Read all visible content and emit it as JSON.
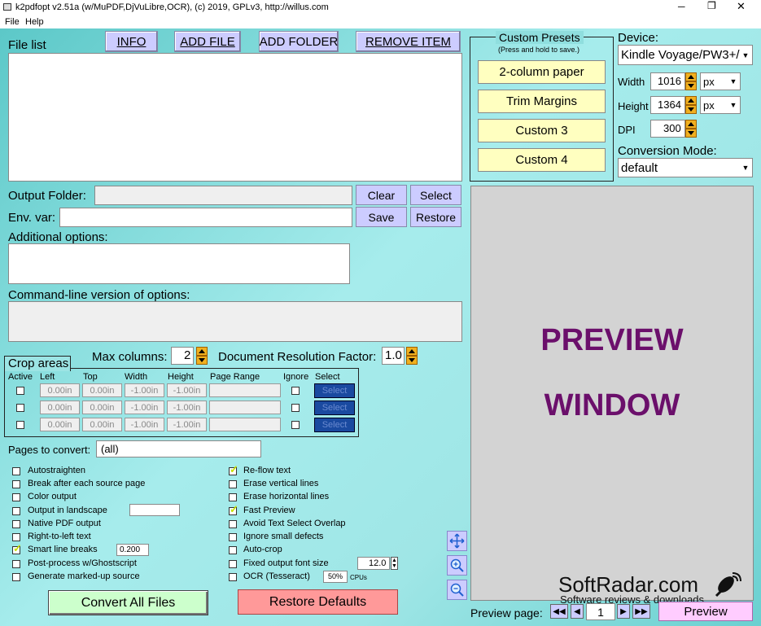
{
  "window": {
    "title": "k2pdfopt v2.51a (w/MuPDF,DjVuLibre,OCR), (c) 2019, GPLv3, http://willus.com",
    "minimize": "─",
    "restore": "❐",
    "close": "✕"
  },
  "menu": {
    "file": "File",
    "help": "Help"
  },
  "filelist": {
    "label": "File list"
  },
  "toolbar": {
    "info": "INFO",
    "add_file": "ADD FILE",
    "add_folder": "ADD FOLDER",
    "remove_item": "REMOVE ITEM"
  },
  "presets": {
    "title": "Custom Presets",
    "subtitle": "(Press and hold to save.)",
    "items": [
      "2-column paper",
      "Trim Margins",
      "Custom 3",
      "Custom 4"
    ]
  },
  "device": {
    "label": "Device:",
    "value": "Kindle Voyage/PW3+/",
    "width_label": "Width",
    "width_value": "1016",
    "width_unit": "px",
    "height_label": "Height",
    "height_value": "1364",
    "height_unit": "px",
    "dpi_label": "DPI",
    "dpi_value": "300",
    "mode_label": "Conversion Mode:",
    "mode_value": "default"
  },
  "output": {
    "folder_label": "Output Folder:",
    "folder_value": "",
    "clear": "Clear",
    "select": "Select",
    "env_label": "Env. var:",
    "env_value": "",
    "save": "Save",
    "restore": "Restore"
  },
  "additional": {
    "label": "Additional options:"
  },
  "cmdline": {
    "label": "Command-line version of options:"
  },
  "crop": {
    "title": "Crop areas",
    "headers": [
      "Active",
      "Left",
      "Top",
      "Width",
      "Height",
      "Page Range",
      "Ignore",
      "Select"
    ],
    "rows": [
      {
        "left": "0.00in",
        "top": "0.00in",
        "width": "-1.00in",
        "height": "-1.00in",
        "select": "Select"
      },
      {
        "left": "0.00in",
        "top": "0.00in",
        "width": "-1.00in",
        "height": "-1.00in",
        "select": "Select"
      },
      {
        "left": "0.00in",
        "top": "0.00in",
        "width": "-1.00in",
        "height": "-1.00in",
        "select": "Select"
      }
    ]
  },
  "maxcols": {
    "label": "Max columns:",
    "value": "2"
  },
  "docres": {
    "label": "Document Resolution Factor:",
    "value": "1.0"
  },
  "pages": {
    "label": "Pages to convert:",
    "value": "(all)"
  },
  "options_left": [
    {
      "label": "Autostraighten",
      "checked": false
    },
    {
      "label": "Break after each source page",
      "checked": false
    },
    {
      "label": "Color output",
      "checked": false
    },
    {
      "label": "Output in landscape",
      "checked": false
    },
    {
      "label": "Native PDF output",
      "checked": false
    },
    {
      "label": "Right-to-left text",
      "checked": false
    },
    {
      "label": "Smart line breaks",
      "checked": true
    },
    {
      "label": "Post-process w/Ghostscript",
      "checked": false
    },
    {
      "label": "Generate marked-up source",
      "checked": false
    }
  ],
  "smart_value": "0.200",
  "options_right": [
    {
      "label": "Re-flow text",
      "checked": true
    },
    {
      "label": "Erase vertical lines",
      "checked": false
    },
    {
      "label": "Erase horizontal lines",
      "checked": false
    },
    {
      "label": "Fast Preview",
      "checked": true
    },
    {
      "label": "Avoid Text Select Overlap",
      "checked": false
    },
    {
      "label": "Ignore small defects",
      "checked": false
    },
    {
      "label": "Auto-crop",
      "checked": false
    },
    {
      "label": "Fixed output font size",
      "checked": false
    },
    {
      "label": "OCR (Tesseract)",
      "checked": false
    }
  ],
  "fontsize_value": "12.0",
  "ocr_cpu_value": "50%",
  "ocr_cpu_label": "CPUs",
  "actions": {
    "convert": "Convert All Files",
    "restore_defaults": "Restore Defaults"
  },
  "preview": {
    "line1": "PREVIEW",
    "line2": "WINDOW",
    "page_label": "Preview page:",
    "page_value": "1",
    "button": "Preview",
    "text_color": "#6b0f6b"
  },
  "watermark": {
    "brand": "SoftRadar.com",
    "tagline": "Software reviews & downloads"
  }
}
